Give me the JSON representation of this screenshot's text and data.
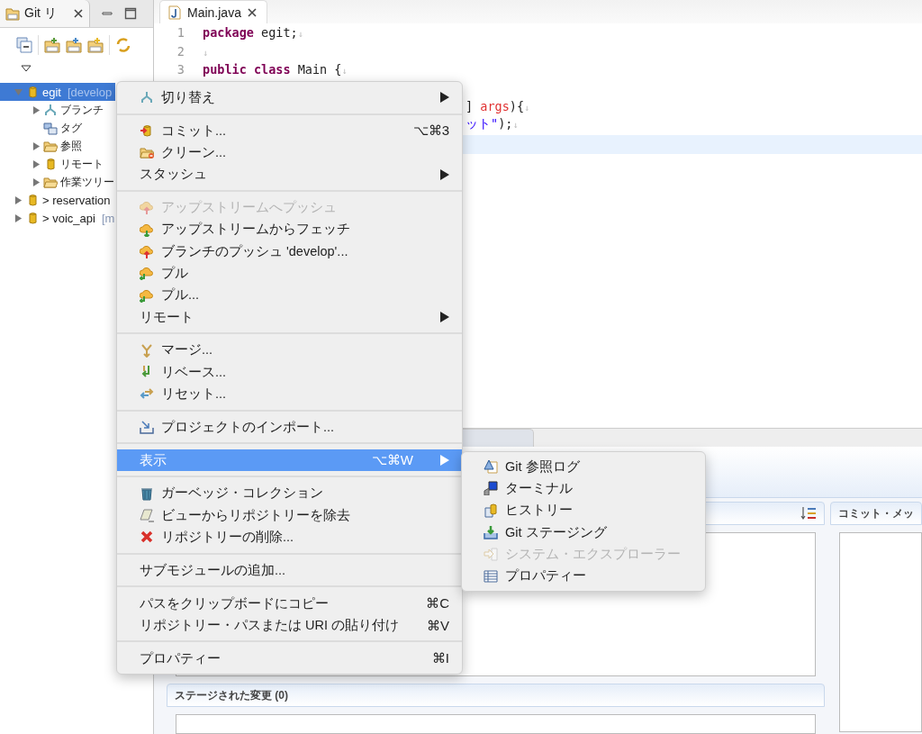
{
  "git_view": {
    "tab": {
      "label": "Git リ",
      "selected": true
    },
    "tree": [
      {
        "kind": "repository",
        "label": "egit",
        "decoration": "[develop",
        "selected": true,
        "expanded": true,
        "leaf": false,
        "children": [
          {
            "kind": "branches",
            "label": "ブランチ",
            "selected": false,
            "expanded": false,
            "leaf": false
          },
          {
            "kind": "tags",
            "label": "タグ",
            "selected": false,
            "leaf": true
          },
          {
            "kind": "references",
            "label": "参照",
            "selected": false,
            "expanded": false,
            "leaf": false
          },
          {
            "kind": "remotes",
            "label": "リモート",
            "selected": false,
            "expanded": false,
            "leaf": false
          },
          {
            "kind": "working-tree",
            "label": "作業ツリー",
            "selected": false,
            "expanded": false,
            "leaf": false
          }
        ]
      },
      {
        "kind": "repository",
        "label": "> reservation",
        "selected": false,
        "expanded": false,
        "leaf": false
      },
      {
        "kind": "repository",
        "label": "> voic_api",
        "decoration": "[m",
        "selected": false,
        "expanded": false,
        "leaf": false
      }
    ]
  },
  "editor": {
    "tab": {
      "label": "Main.java",
      "selected": true
    },
    "lines": [
      {
        "kind": "full",
        "number": "1",
        "tokens": [
          {
            "kind": "keyword",
            "text": "package"
          },
          {
            "kind": "plain",
            "text": " egit;"
          },
          {
            "kind": "mark",
            "text": "↓"
          }
        ]
      },
      {
        "kind": "full",
        "number": "2",
        "tokens": [
          {
            "kind": "mark",
            "text": "↓"
          }
        ]
      },
      {
        "kind": "full",
        "number": "3",
        "tokens": [
          {
            "kind": "keyword",
            "text": "public class"
          },
          {
            "kind": "plain",
            "text": " Main {"
          },
          {
            "kind": "mark",
            "text": "↓"
          }
        ]
      },
      {
        "kind": "hidden"
      },
      {
        "kind": "partial",
        "tokens": [
          {
            "kind": "plain",
            "text": "] "
          },
          {
            "kind": "param",
            "text": "args"
          },
          {
            "kind": "plain",
            "text": "){"
          },
          {
            "kind": "mark",
            "text": "↓"
          }
        ]
      },
      {
        "kind": "partial",
        "tokens": [
          {
            "kind": "string",
            "text": "ット\""
          },
          {
            "kind": "plain",
            "text": ");"
          },
          {
            "kind": "mark",
            "text": "↓"
          }
        ]
      },
      {
        "kind": "current"
      }
    ]
  },
  "context_menu": {
    "groups": [
      [
        {
          "label": "切り替え",
          "submenu": true,
          "disabled": false,
          "selected": false
        }
      ],
      [
        {
          "label": "コミット...",
          "shortcut": "⌥⌘3",
          "submenu": false,
          "disabled": false,
          "selected": false
        },
        {
          "label": "クリーン...",
          "submenu": false,
          "disabled": false,
          "selected": false
        },
        {
          "label": "スタッシュ",
          "submenu": true,
          "disabled": false,
          "selected": false
        }
      ],
      [
        {
          "label": "アップストリームへプッシュ",
          "submenu": false,
          "disabled": true,
          "selected": false
        },
        {
          "label": "アップストリームからフェッチ",
          "submenu": false,
          "disabled": false,
          "selected": false
        },
        {
          "label": "ブランチのプッシュ 'develop'...",
          "submenu": false,
          "disabled": false,
          "selected": false
        },
        {
          "label": "プル",
          "submenu": false,
          "disabled": false,
          "selected": false
        },
        {
          "label": "プル...",
          "submenu": false,
          "disabled": false,
          "selected": false
        },
        {
          "label": "リモート",
          "submenu": true,
          "disabled": false,
          "selected": false
        }
      ],
      [
        {
          "label": "マージ...",
          "submenu": false,
          "disabled": false,
          "selected": false
        },
        {
          "label": "リベース...",
          "submenu": false,
          "disabled": false,
          "selected": false
        },
        {
          "label": "リセット...",
          "submenu": false,
          "disabled": false,
          "selected": false
        }
      ],
      [
        {
          "label": "プロジェクトのインポート...",
          "submenu": false,
          "disabled": false,
          "selected": false
        }
      ],
      [
        {
          "label": "表示",
          "shortcut": "⌥⌘W",
          "submenu": true,
          "disabled": false,
          "selected": true
        }
      ],
      [
        {
          "label": "ガーベッジ・コレクション",
          "submenu": false,
          "disabled": false,
          "selected": false
        },
        {
          "label": "ビューからリポジトリーを除去",
          "submenu": false,
          "disabled": false,
          "selected": false
        },
        {
          "label": "リポジトリーの削除...",
          "submenu": false,
          "disabled": false,
          "selected": false
        }
      ],
      [
        {
          "label": "サブモジュールの追加...",
          "submenu": false,
          "disabled": false,
          "selected": false
        }
      ],
      [
        {
          "label": "パスをクリップボードにコピー",
          "shortcut": "⌘C",
          "submenu": false,
          "disabled": false,
          "selected": false
        },
        {
          "label": "リポジトリー・パスまたは URI の貼り付け",
          "shortcut": "⌘V",
          "submenu": false,
          "disabled": false,
          "selected": false
        }
      ],
      [
        {
          "label": "プロパティー",
          "shortcut": "⌘I",
          "submenu": false,
          "disabled": false,
          "selected": false
        }
      ]
    ]
  },
  "submenu": {
    "items": [
      {
        "label": "Git 参照ログ",
        "disabled": false
      },
      {
        "label": "ターミナル",
        "disabled": false
      },
      {
        "label": "ヒストリー",
        "disabled": false
      },
      {
        "label": "Git ステージング",
        "disabled": false
      },
      {
        "label": "システム・エクスプローラー",
        "disabled": true
      },
      {
        "label": "プロパティー",
        "disabled": false
      }
    ]
  },
  "staging": {
    "commit_message": {
      "title": "コミット・メッ"
    },
    "staged": {
      "title": "ステージされた変更 (0)"
    }
  }
}
